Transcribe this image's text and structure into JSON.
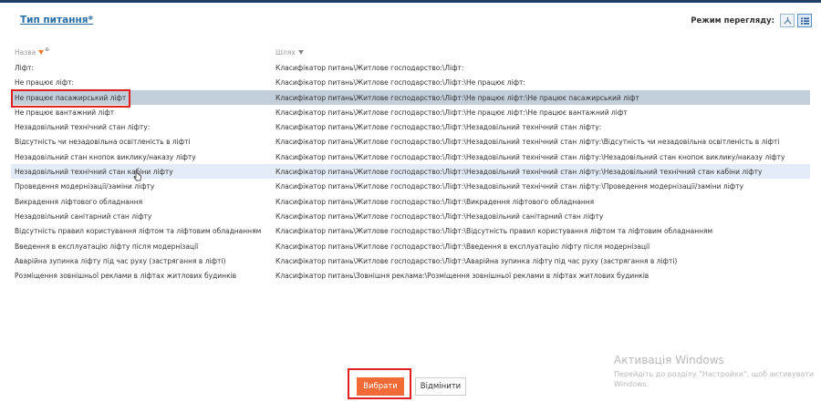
{
  "header": {
    "title": "Тип питання*",
    "view_mode_label": "Режим перегляду:",
    "view_buttons": [
      "tree-view-icon",
      "list-view-icon"
    ]
  },
  "table": {
    "columns": [
      "Назва",
      "Шлях"
    ],
    "rows": [
      {
        "name": "Ліфт:",
        "path": "Класифікатор питань\\Житлове господарство:\\Ліфт:"
      },
      {
        "name": "Не працює ліфт:",
        "path": "Класифікатор питань\\Житлове господарство:\\Ліфт:\\Не працює ліфт:"
      },
      {
        "name": "Не працює пасажирський ліфт",
        "path": "Класифікатор питань\\Житлове господарство:\\Ліфт:\\Не працює ліфт:\\Не працює пасажирський ліфт"
      },
      {
        "name": "Не працює вантажний ліфт",
        "path": "Класифікатор питань\\Житлове господарство:\\Ліфт:\\Не працює ліфт:\\Не працює вантажний ліфт"
      },
      {
        "name": "Незадовільний технічний стан ліфту:",
        "path": "Класифікатор питань\\Житлове господарство:\\Ліфт:\\Незадовільний технічний стан ліфту:"
      },
      {
        "name": "Відсутність чи незадовільна освітленість в ліфті",
        "path": "Класифікатор питань\\Житлове господарство:\\Ліфт:\\Незадовільний технічний стан ліфту:\\Відсутність чи незадовільна освітленість в ліфті"
      },
      {
        "name": "Незадовільний стан кнопок виклику/наказу ліфту",
        "path": "Класифікатор питань\\Житлове господарство:\\Ліфт:\\Незадовільний технічний стан ліфту:\\Незадовільний стан кнопок виклику/наказу ліфту"
      },
      {
        "name": "Незадовільний технічний стан кабіни ліфту",
        "path": "Класифікатор питань\\Житлове господарство:\\Ліфт:\\Незадовільний технічний стан ліфту:\\Незадовільний технічний стан кабіни ліфту"
      },
      {
        "name": "Проведення модернізації/заміни ліфту",
        "path": "Класифікатор питань\\Житлове господарство:\\Ліфт:\\Незадовільний технічний стан ліфту:\\Проведення модернізації/заміни ліфту"
      },
      {
        "name": "Викрадення ліфтового обладнання",
        "path": "Класифікатор питань\\Житлове господарство:\\Ліфт:\\Викрадення ліфтового обладнання"
      },
      {
        "name": "Незадовільний санітарний стан ліфту",
        "path": "Класифікатор питань\\Житлове господарство:\\Ліфт:\\Незадовільний санітарний стан ліфту"
      },
      {
        "name": "Відсутність правил користування ліфтом та ліфтовим обладнанням",
        "path": "Класифікатор питань\\Житлове господарство:\\Ліфт:\\Відсутність правил користування ліфтом та ліфтовим обладнанням"
      },
      {
        "name": "Введення в експлуатацію ліфту після модернізації",
        "path": "Класифікатор питань\\Житлове господарство:\\Ліфт:\\Введення в експлуатацію ліфту після модернізації"
      },
      {
        "name": "Аварійна зупинка ліфту під час руху (застрягання в ліфті)",
        "path": "Класифікатор питань\\Житлове господарство:\\Ліфт:\\Аварійна зупинка ліфту під час руху (застрягання в ліфті)"
      },
      {
        "name": "Розміщення зовнішньої реклами в ліфтах житлових будинків",
        "path": "Класифікатор питань\\Зовнішня реклама:\\Розміщення зовнішньої реклами в ліфтах житлових будинків"
      }
    ]
  },
  "footer": {
    "select_label": "Вибрати",
    "cancel_label": "Відмінити"
  },
  "watermark": {
    "title": "Активація Windows",
    "subtitle": "Перейдіть до розділу \"Настройки\", щоб активувати Windows."
  },
  "colors": {
    "accent": "#f26a35",
    "link": "#2a6fa8",
    "selected_row": "#c3cedb",
    "highlight_box": "#e02020"
  }
}
